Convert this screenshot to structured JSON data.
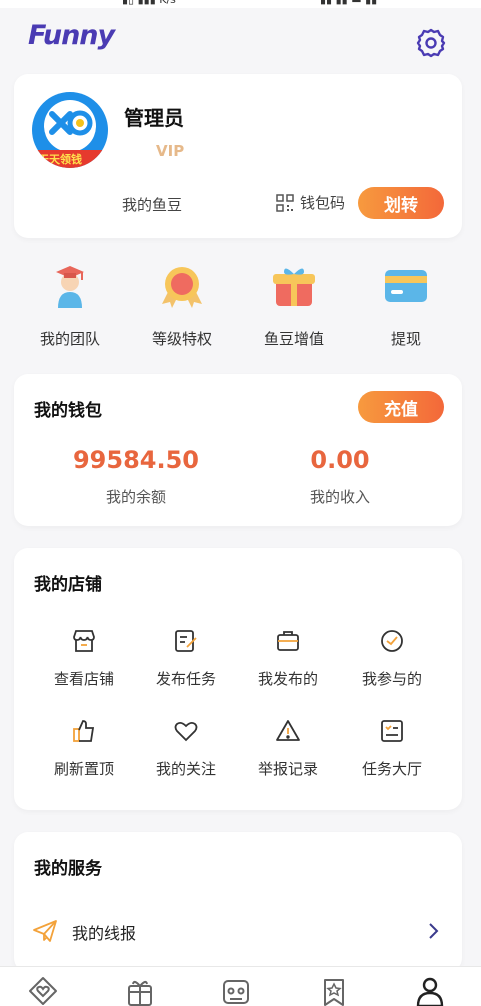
{
  "app": {
    "logo_text": "Funny",
    "brand_color": "#4a3bb3",
    "accent_color": "#f3683a"
  },
  "header": {
    "settings_icon": "gear-icon"
  },
  "profile": {
    "username": "管理员",
    "level": "VIP",
    "fishbean_label": "我的鱼豆",
    "wallet_code_label": "钱包码",
    "transfer_label": "划转",
    "avatar_banner_text": "天天领钱"
  },
  "quick_actions": [
    {
      "label": "我的团队",
      "icon": "team-icon"
    },
    {
      "label": "等级特权",
      "icon": "medal-icon"
    },
    {
      "label": "鱼豆增值",
      "icon": "gift-box-icon"
    },
    {
      "label": "提现",
      "icon": "card-icon"
    }
  ],
  "wallet": {
    "title": "我的钱包",
    "recharge_label": "充值",
    "balance": "99584.50",
    "balance_label": "我的余额",
    "income": "0.00",
    "income_label": "我的收入"
  },
  "store": {
    "title": "我的店铺",
    "items": [
      {
        "label": "查看店铺",
        "icon": "store-icon"
      },
      {
        "label": "发布任务",
        "icon": "edit-task-icon"
      },
      {
        "label": "我发布的",
        "icon": "briefcase-icon"
      },
      {
        "label": "我参与的",
        "icon": "check-circle-icon"
      },
      {
        "label": "刷新置顶",
        "icon": "thumbs-up-icon"
      },
      {
        "label": "我的关注",
        "icon": "heart-icon"
      },
      {
        "label": "举报记录",
        "icon": "warning-icon"
      },
      {
        "label": "任务大厅",
        "icon": "task-list-icon"
      }
    ]
  },
  "services": {
    "title": "我的服务",
    "items": [
      {
        "label": "我的线报",
        "icon": "paper-plane-icon"
      }
    ]
  },
  "bottom_nav": [
    {
      "icon": "diamond-heart-icon"
    },
    {
      "icon": "gift-icon"
    },
    {
      "icon": "gamepad-icon"
    },
    {
      "icon": "star-bookmark-icon"
    },
    {
      "icon": "person-icon"
    }
  ]
}
